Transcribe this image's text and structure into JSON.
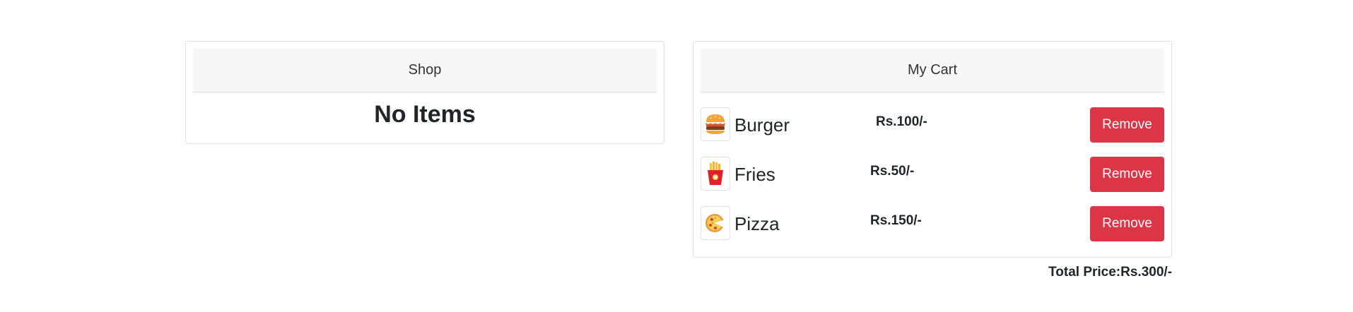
{
  "shop": {
    "title": "Shop",
    "empty_text": "No Items"
  },
  "cart": {
    "title": "My Cart",
    "items": [
      {
        "name": "Burger",
        "price": "Rs.100/-",
        "remove_label": "Remove",
        "icon": "burger-icon"
      },
      {
        "name": "Fries",
        "price": "Rs.50/-",
        "remove_label": "Remove",
        "icon": "fries-icon"
      },
      {
        "name": "Pizza",
        "price": "Rs.150/-",
        "remove_label": "Remove",
        "icon": "pizza-icon"
      }
    ],
    "total_label": "Total Price:",
    "total_value": "Rs.300/-"
  },
  "colors": {
    "remove_button": "#dc3545",
    "header_bg": "#f7f7f7",
    "border": "#dee2e6"
  }
}
